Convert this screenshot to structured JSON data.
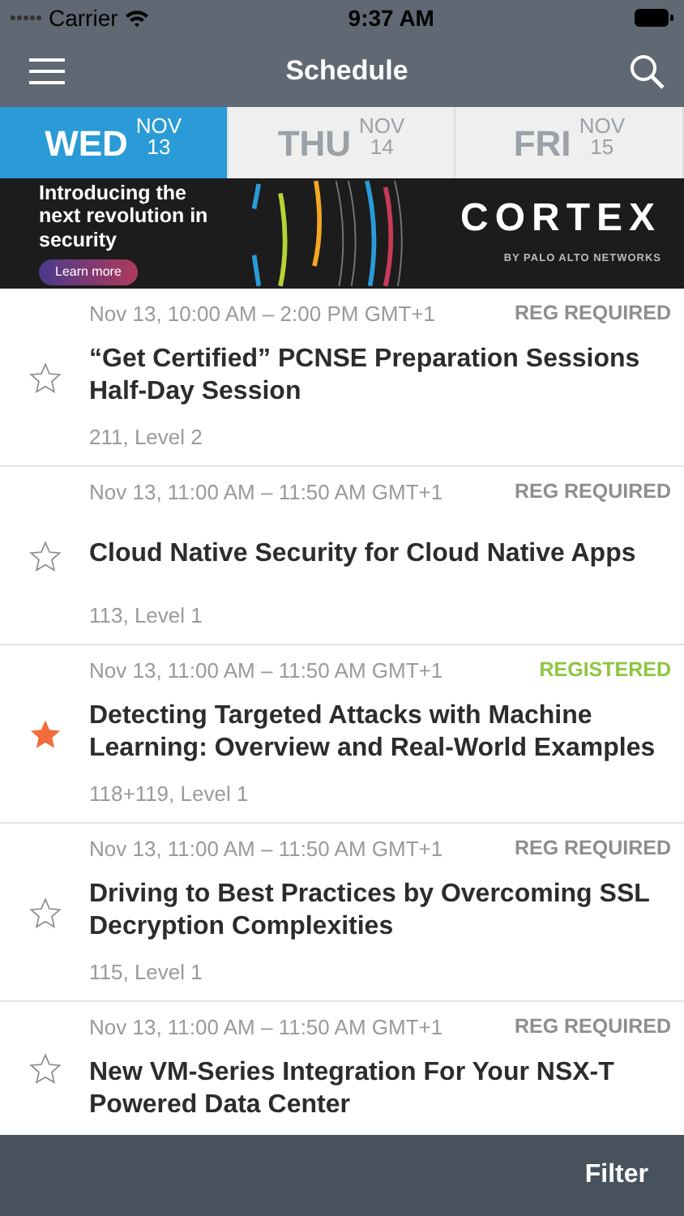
{
  "status_bar": {
    "carrier": "Carrier",
    "time": "9:37 AM"
  },
  "nav_bar": {
    "title": "Schedule"
  },
  "day_tabs": [
    {
      "day": "WED",
      "month": "NOV",
      "date": "13",
      "selected": true
    },
    {
      "day": "THU",
      "month": "NOV",
      "date": "14",
      "selected": false
    },
    {
      "day": "FRI",
      "month": "NOV",
      "date": "15",
      "selected": false
    }
  ],
  "banner": {
    "headline": "Introducing the next revolution in security",
    "button": "Learn more",
    "logo": "CORTEX",
    "logo_sub": "BY PALO ALTO NETWORKS"
  },
  "sessions": [
    {
      "time": "Nov 13, 10:00 AM – 2:00 PM GMT+1",
      "status": "REG REQUIRED",
      "kind": "required",
      "title": "“Get Certified” PCNSE Preparation Sessions Half-Day Session",
      "location": "211, Level 2",
      "starred": false
    },
    {
      "time": "Nov 13, 11:00 AM – 11:50 AM GMT+1",
      "status": "REG REQUIRED",
      "kind": "required",
      "title": "Cloud Native Security for Cloud Native Apps",
      "location": "113, Level 1",
      "starred": false
    },
    {
      "time": "Nov 13, 11:00 AM – 11:50 AM GMT+1",
      "status": "REGISTERED",
      "kind": "registered",
      "title": "Detecting Targeted Attacks with Machine Learning: Overview and Real-World Examples",
      "location": "118+119, Level 1",
      "starred": true
    },
    {
      "time": "Nov 13, 11:00 AM – 11:50 AM GMT+1",
      "status": "REG REQUIRED",
      "kind": "required",
      "title": "Driving to Best Practices by Overcoming SSL Decryption Complexities",
      "location": "115, Level 1",
      "starred": false
    },
    {
      "time": "Nov 13, 11:00 AM – 11:50 AM GMT+1",
      "status": "REG REQUIRED",
      "kind": "required",
      "title": "New VM-Series Integration For Your NSX-T Powered Data Center",
      "starred": false
    }
  ],
  "footer": {
    "filter": "Filter"
  }
}
